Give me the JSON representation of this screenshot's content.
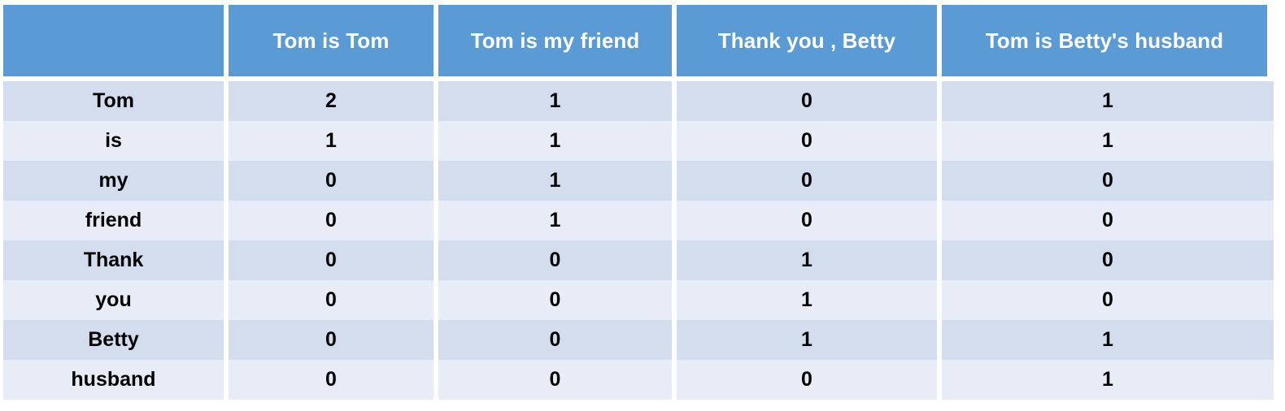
{
  "table": {
    "columns": [
      "",
      "Tom is Tom",
      "Tom is my friend",
      "Thank you , Betty",
      "Tom is Betty's husband"
    ],
    "rows": [
      {
        "term": "Tom",
        "counts": [
          "2",
          "1",
          "0",
          "1"
        ]
      },
      {
        "term": "is",
        "counts": [
          "1",
          "1",
          "0",
          "1"
        ]
      },
      {
        "term": "my",
        "counts": [
          "0",
          "1",
          "0",
          "0"
        ]
      },
      {
        "term": "friend",
        "counts": [
          "0",
          "1",
          "0",
          "0"
        ]
      },
      {
        "term": "Thank",
        "counts": [
          "0",
          "0",
          "1",
          "0"
        ]
      },
      {
        "term": "you",
        "counts": [
          "0",
          "0",
          "1",
          "0"
        ]
      },
      {
        "term": "Betty",
        "counts": [
          "0",
          "0",
          "1",
          "1"
        ]
      },
      {
        "term": "husband",
        "counts": [
          "0",
          "0",
          "0",
          "1"
        ]
      }
    ]
  },
  "colors": {
    "header_background": "#5b9bd5",
    "header_text": "#ffffff",
    "row_odd_background": "#d3ddee",
    "row_even_background": "#e8ecf7",
    "body_text": "#000000",
    "page_background": "#ffffff"
  },
  "chart_data": {
    "type": "table",
    "title": "",
    "xlabel": "",
    "ylabel": "",
    "categories": [
      "Tom is Tom",
      "Tom is my friend",
      "Thank you , Betty",
      "Tom is Betty's husband"
    ],
    "index": [
      "Tom",
      "is",
      "my",
      "friend",
      "Thank",
      "you",
      "Betty",
      "husband"
    ],
    "series": [
      {
        "name": "Tom is Tom",
        "values": [
          2,
          1,
          0,
          0,
          0,
          0,
          0,
          0
        ]
      },
      {
        "name": "Tom is my friend",
        "values": [
          1,
          1,
          1,
          1,
          0,
          0,
          0,
          0
        ]
      },
      {
        "name": "Thank you , Betty",
        "values": [
          0,
          0,
          0,
          0,
          1,
          1,
          1,
          0
        ]
      },
      {
        "name": "Tom is Betty's husband",
        "values": [
          1,
          1,
          0,
          0,
          0,
          0,
          1,
          1
        ]
      }
    ],
    "grid": false,
    "legend": "none"
  }
}
